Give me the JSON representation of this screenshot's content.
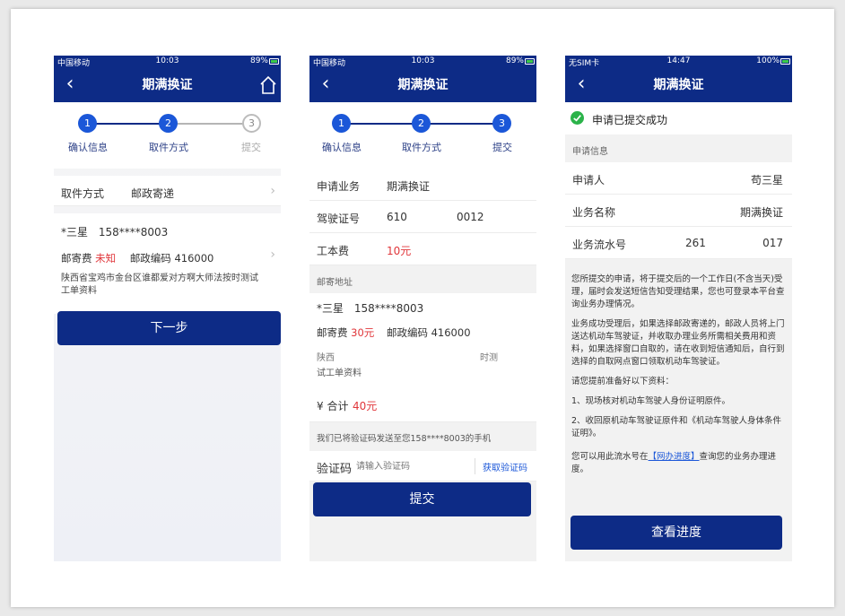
{
  "phone1": {
    "status": {
      "carrier": "中国移动",
      "time": "10:03",
      "battery": "89%"
    },
    "nav": {
      "title": "期满换证"
    },
    "steps": [
      {
        "num": "1",
        "label": "确认信息"
      },
      {
        "num": "2",
        "label": "取件方式"
      },
      {
        "num": "3",
        "label": "提交"
      }
    ],
    "pickup": {
      "label": "取件方式",
      "value": "邮政寄递"
    },
    "recipient": {
      "name": "*三星",
      "phone": "158****8003"
    },
    "postage": {
      "label": "邮寄费",
      "value": "未知",
      "postcode_label": "邮政编码",
      "postcode": "416000"
    },
    "address": "陕西省宝鸡市金台区谁都爱对方啊大师法按时测试工单资料",
    "next_button": "下一步"
  },
  "phone2": {
    "status": {
      "carrier": "中国移动",
      "time": "10:03",
      "battery": "89%"
    },
    "nav": {
      "title": "期满换证"
    },
    "steps": [
      {
        "num": "1",
        "label": "确认信息"
      },
      {
        "num": "2",
        "label": "取件方式"
      },
      {
        "num": "3",
        "label": "提交"
      }
    ],
    "business": {
      "label": "申请业务",
      "value": "期满换证"
    },
    "license": {
      "label": "驾驶证号",
      "value_start": "610",
      "value_end": "0012"
    },
    "fee": {
      "label": "工本费",
      "value": "10元"
    },
    "mail_section": "邮寄地址",
    "recipient": {
      "name": "*三星",
      "phone": "158****8003"
    },
    "postage": {
      "label": "邮寄费",
      "value": "30元",
      "postcode_label": "邮政编码",
      "postcode": "416000"
    },
    "address_line1_start": "陕西",
    "address_line1_end": "时测",
    "address_line2": "试工单资料",
    "total": {
      "label": "¥ 合计",
      "value": "40元"
    },
    "sms_notice": "我们已将验证码发送至您158****8003的手机",
    "code": {
      "label": "验证码",
      "placeholder": "请输入验证码",
      "get_code": "获取验证码"
    },
    "submit_button": "提交"
  },
  "phone3": {
    "status": {
      "carrier": "无SIM卡",
      "time": "14:47",
      "battery": "100%"
    },
    "nav": {
      "title": "期满换证"
    },
    "success": "申请已提交成功",
    "info_section": "申请信息",
    "applicant": {
      "label": "申请人",
      "value": "苟三星"
    },
    "business_name": {
      "label": "业务名称",
      "value": "期满换证"
    },
    "serial": {
      "label": "业务流水号",
      "value_start": "261",
      "value_end": "017"
    },
    "paragraphs": [
      "您所提交的申请，将于提交后的一个工作日(不含当天)受理，届时会发送短信告知受理结果，您也可登录本平台查询业务办理情况。",
      "业务成功受理后，如果选择邮政寄递的，邮政人员将上门送达机动车驾驶证，并收取办理业务所需相关费用和资料，如果选择窗口自取的，请在收到短信通知后，自行到选择的自取网点窗口领取机动车驾驶证。",
      "请您提前准备好以下资料：",
      "1、现场核对机动车驾驶人身份证明原件。",
      "2、收回原机动车驾驶证原件和《机动车驾驶人身体条件证明》。"
    ],
    "query_prefix": "您可以用此流水号在",
    "query_link": "【网办进度】",
    "query_suffix": "查询您的业务办理进度。",
    "progress_button": "查看进度"
  },
  "colors": {
    "primary": "#0d2b86",
    "step_blue": "#1b57d8",
    "red": "#e0363a",
    "success": "#2bb34a"
  }
}
